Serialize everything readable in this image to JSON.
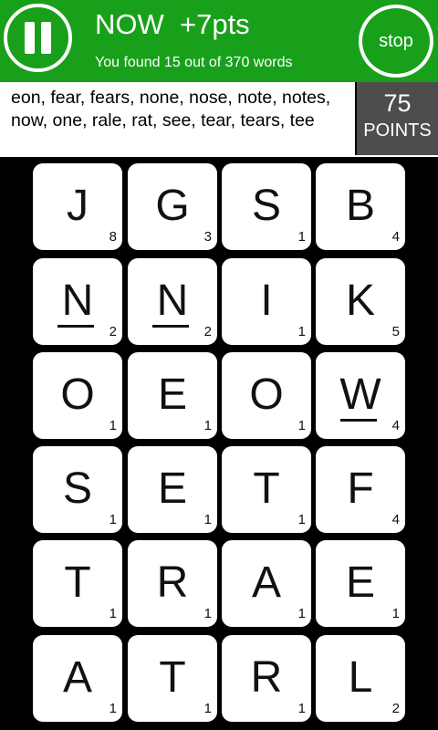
{
  "header": {
    "title": "NOW  +7pts",
    "subtitle": "You found 15 out of 370 words",
    "stop_label": "stop",
    "color": "#19a01b"
  },
  "found_words": "eon, fear, fears, none, nose, note, notes, now, one, rale, rat, see, tear, tears, tee",
  "points": {
    "value": "75",
    "label": "POINTS"
  },
  "board": [
    [
      {
        "letter": "J",
        "score": "8"
      },
      {
        "letter": "G",
        "score": "3"
      },
      {
        "letter": "S",
        "score": "1"
      },
      {
        "letter": "B",
        "score": "4"
      }
    ],
    [
      {
        "letter": "N",
        "score": "2",
        "underlined": true
      },
      {
        "letter": "N",
        "score": "2",
        "underlined": true
      },
      {
        "letter": "I",
        "score": "1"
      },
      {
        "letter": "K",
        "score": "5"
      }
    ],
    [
      {
        "letter": "O",
        "score": "1"
      },
      {
        "letter": "E",
        "score": "1"
      },
      {
        "letter": "O",
        "score": "1"
      },
      {
        "letter": "W",
        "score": "4",
        "underlined": true
      }
    ],
    [
      {
        "letter": "S",
        "score": "1"
      },
      {
        "letter": "E",
        "score": "1"
      },
      {
        "letter": "T",
        "score": "1"
      },
      {
        "letter": "F",
        "score": "4"
      }
    ],
    [
      {
        "letter": "T",
        "score": "1"
      },
      {
        "letter": "R",
        "score": "1"
      },
      {
        "letter": "A",
        "score": "1"
      },
      {
        "letter": "E",
        "score": "1"
      }
    ],
    [
      {
        "letter": "A",
        "score": "1"
      },
      {
        "letter": "T",
        "score": "1"
      },
      {
        "letter": "R",
        "score": "1"
      },
      {
        "letter": "L",
        "score": "2"
      }
    ]
  ]
}
